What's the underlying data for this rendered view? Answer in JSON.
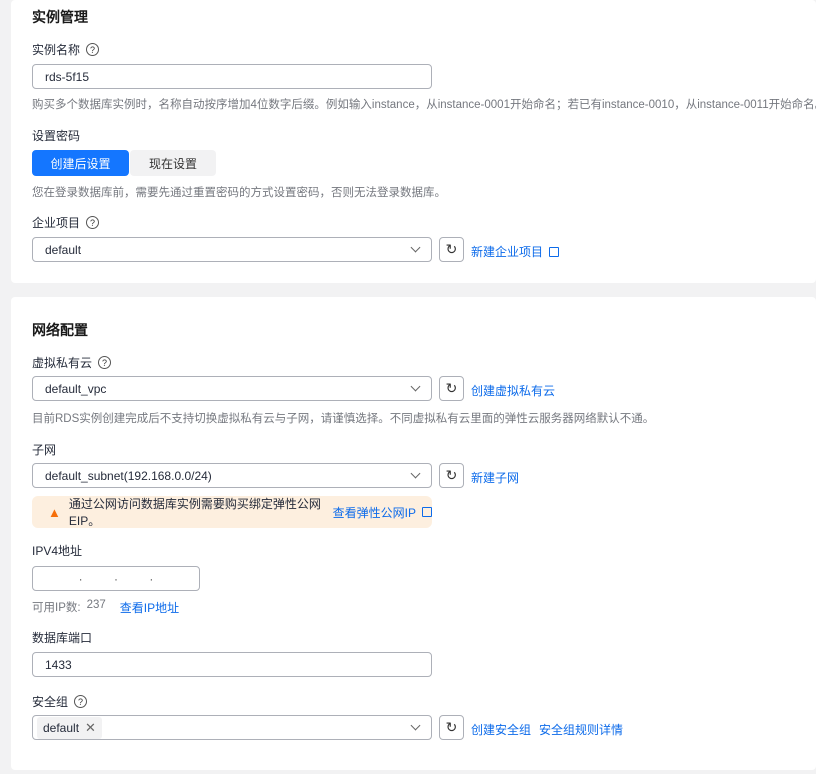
{
  "instance": {
    "title": "实例管理",
    "name_label": "实例名称",
    "name_value": "rds-5f15",
    "name_hint": "购买多个数据库实例时，名称自动按序增加4位数字后缀。例如输入instance，从instance-0001开始命名；若已有instance-0010，从instance-0011开始命名。",
    "password_label": "设置密码",
    "password_options": [
      "创建后设置",
      "现在设置"
    ],
    "password_hint": "您在登录数据库前，需要先通过重置密码的方式设置密码，否则无法登录数据库。",
    "project_label": "企业项目",
    "project_value": "default",
    "project_link": "新建企业项目"
  },
  "network": {
    "title": "网络配置",
    "vpc_label": "虚拟私有云",
    "vpc_value": "default_vpc",
    "vpc_link": "创建虚拟私有云",
    "vpc_hint": "目前RDS实例创建完成后不支持切换虚拟私有云与子网，请谨慎选择。不同虚拟私有云里面的弹性云服务器网络默认不通。",
    "subnet_label": "子网",
    "subnet_value": "default_subnet(192.168.0.0/24)",
    "subnet_link": "新建子网",
    "alert_text": "通过公网访问数据库实例需要购买绑定弹性公网EIP。",
    "alert_link": "查看弹性公网IP",
    "ipv4_label": "IPV4地址",
    "ip_available_label": "可用IP数:",
    "ip_available_count": "237",
    "ip_link": "查看IP地址",
    "port_label": "数据库端口",
    "port_value": "1433",
    "sg_label": "安全组",
    "sg_tag": "default",
    "sg_link1": "创建安全组",
    "sg_link2": "安全组规则详情"
  },
  "colors": {
    "primary": "#1476ff",
    "link": "#0d6bea",
    "alert_bg": "#fdefdf",
    "warning": "#f66f0b"
  }
}
